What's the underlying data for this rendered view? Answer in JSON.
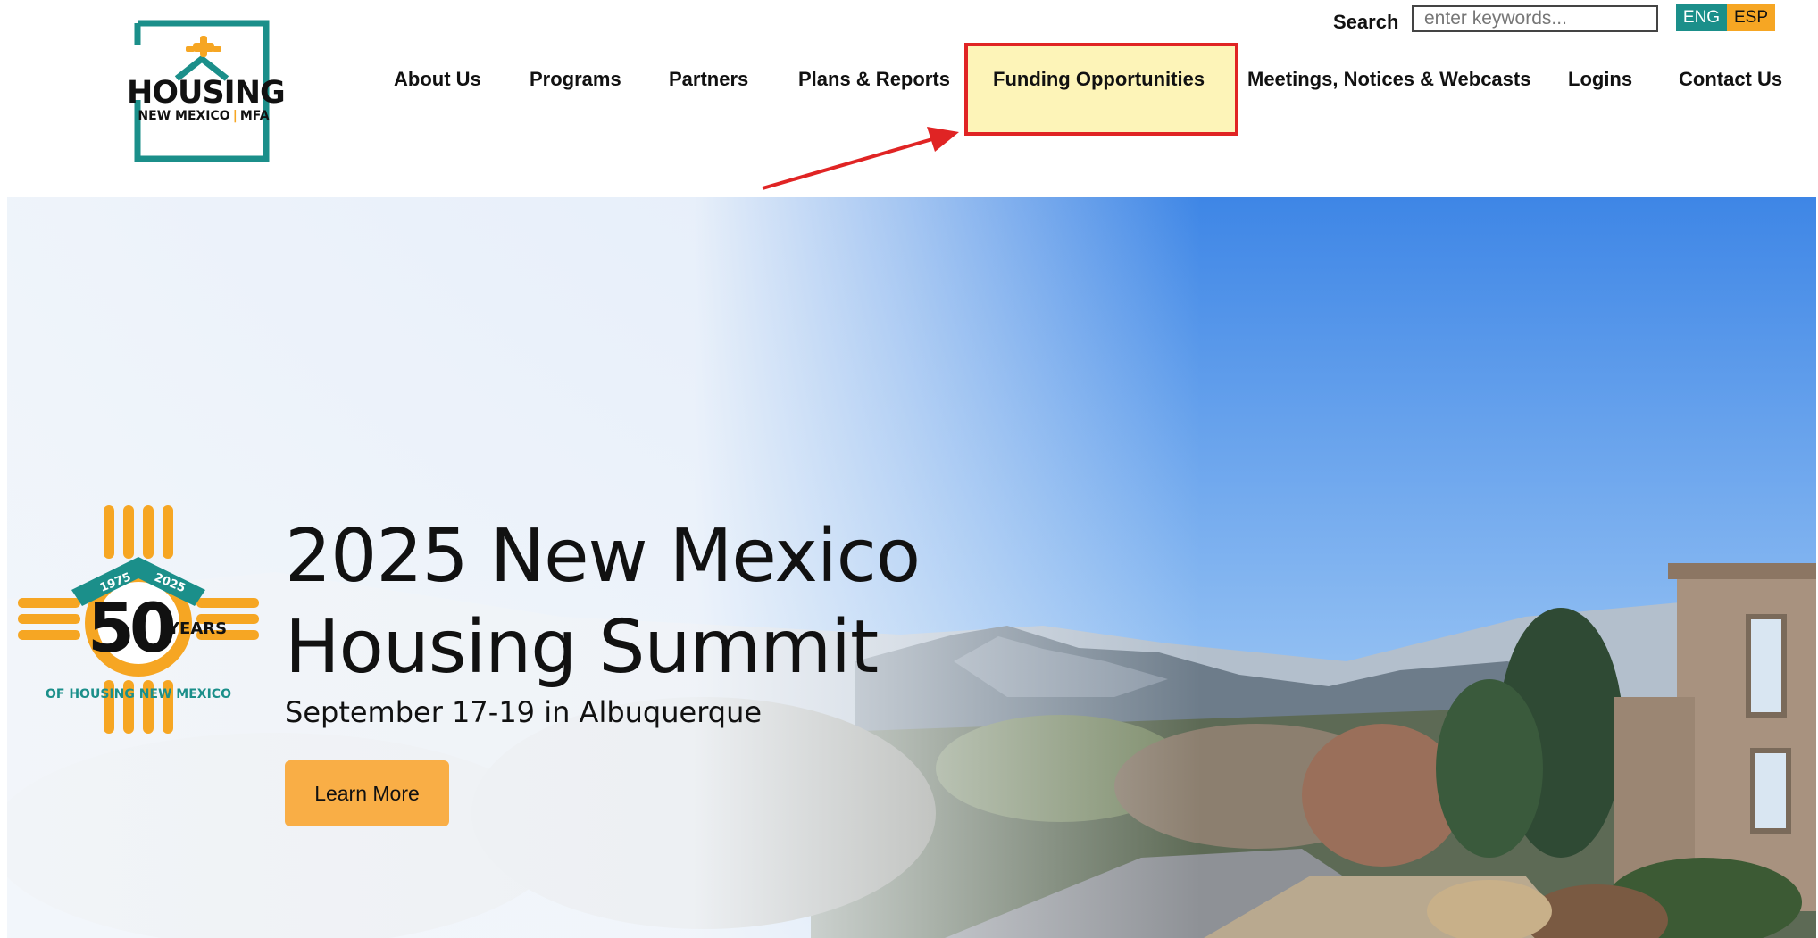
{
  "header": {
    "logo": {
      "word": "HOUSING",
      "subtitle_left": "NEW MEXICO",
      "subtitle_sep": "|",
      "subtitle_right": "MFA"
    },
    "search": {
      "label": "Search",
      "placeholder": "enter keywords..."
    },
    "languages": {
      "eng": "ENG",
      "esp": "ESP"
    },
    "nav": {
      "about": "About Us",
      "programs": "Programs",
      "partners": "Partners",
      "plans": "Plans & Reports",
      "funding": "Funding Opportunities",
      "meetings": "Meetings, Notices & Webcasts",
      "logins": "Logins",
      "contact": "Contact Us"
    }
  },
  "hero": {
    "badge": {
      "number": "50",
      "years": "YEARS",
      "year_start": "1975",
      "year_end": "2025",
      "tagline": "OF HOUSING NEW MEXICO"
    },
    "title_line1": "2025 New Mexico",
    "title_line2": "Housing Summit",
    "subtitle": "September 17-19 in Albuquerque",
    "cta": "Learn More"
  },
  "colors": {
    "teal": "#1b8f8a",
    "gold": "#f6a623",
    "highlight_border": "#e02424",
    "highlight_fill": "#fdf4b8",
    "cta": "#f9ae46"
  },
  "icons": {
    "logo": "new-mexico-state-outline-house-logo",
    "badge": "zia-sun-50-years-badge",
    "annotation": "red-arrow-icon"
  }
}
